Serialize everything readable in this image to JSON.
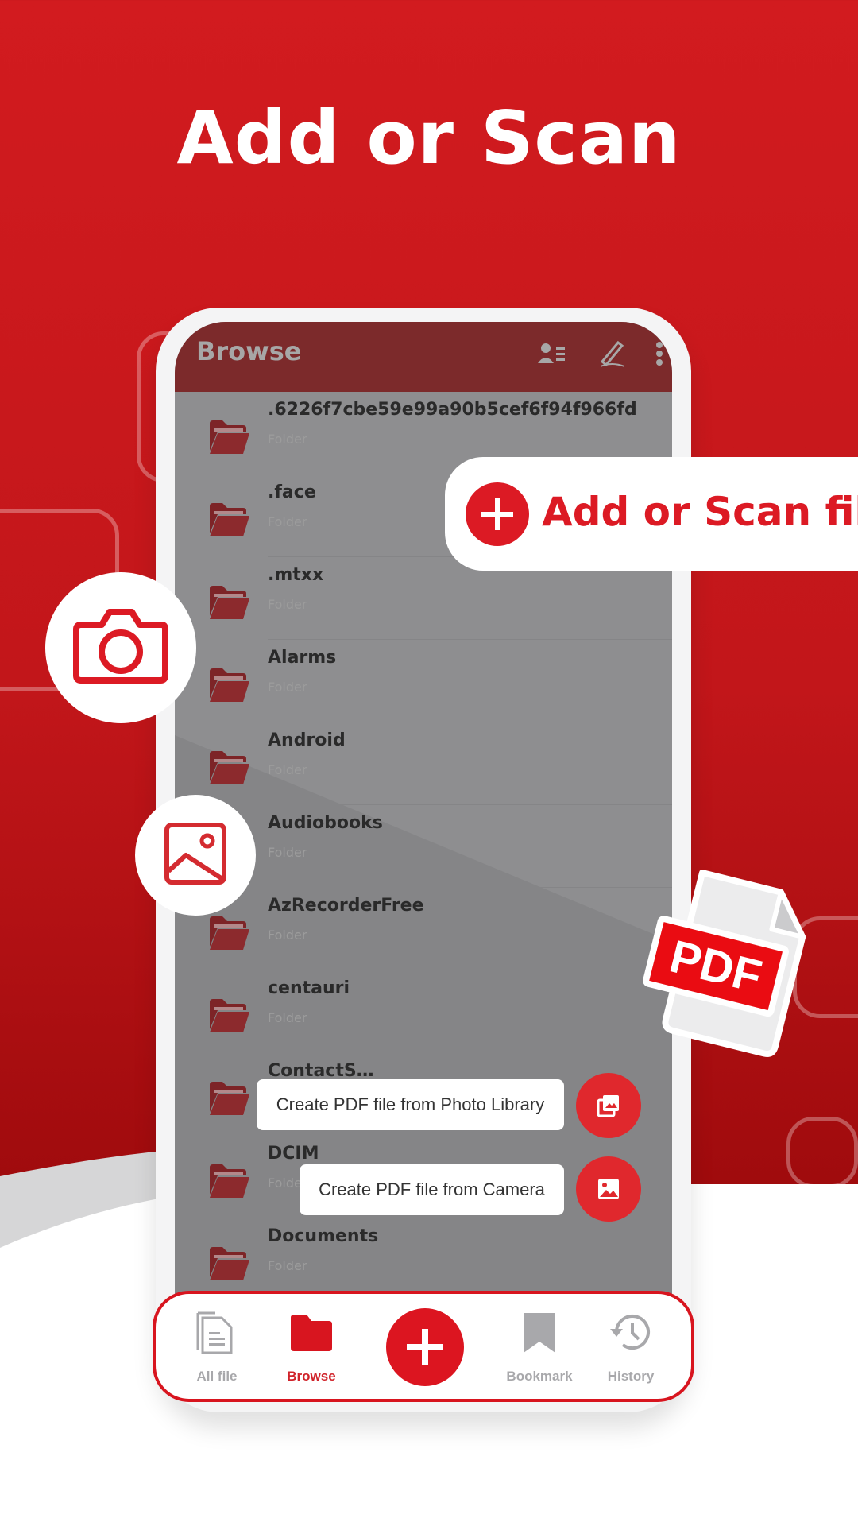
{
  "hero": {
    "title": "Add or Scan"
  },
  "colors": {
    "brand_red": "#dc1a24",
    "appbar": "#7c2a2b",
    "muted_icon": "#a8a8ab"
  },
  "app": {
    "title": "Browse",
    "toolbar_icons": [
      "contacts-list-icon",
      "signature-pen-icon",
      "more-vert-icon"
    ],
    "folders": [
      {
        "name": ".6226f7cbe59e99a90b5cef6f94f966fd",
        "type": "Folder"
      },
      {
        "name": ".face",
        "type": "Folder"
      },
      {
        "name": ".mtxx",
        "type": "Folder"
      },
      {
        "name": "Alarms",
        "type": "Folder"
      },
      {
        "name": "Android",
        "type": "Folder"
      },
      {
        "name": "Audiobooks",
        "type": "Folder"
      },
      {
        "name": "AzRecorderFree",
        "type": "Folder"
      },
      {
        "name": "centauri",
        "type": "Folder"
      },
      {
        "name": "ContactS…",
        "type": "Folder"
      },
      {
        "name": "DCIM",
        "type": "Folder"
      },
      {
        "name": "Documents",
        "type": "Folder"
      }
    ]
  },
  "callout": {
    "label": "Add or Scan file",
    "icon": "plus-icon"
  },
  "floating": {
    "camera_icon": "camera-icon",
    "gallery_icon": "image-icon",
    "pdf_badge": "PDF"
  },
  "speed_dial": [
    {
      "label": "Create PDF file from Photo Library",
      "icon": "photo-library-icon"
    },
    {
      "label": "Create PDF file from Camera",
      "icon": "image-icon"
    }
  ],
  "bottom_nav": {
    "items": [
      {
        "label": "All file",
        "icon": "document-icon",
        "active": false
      },
      {
        "label": "Browse",
        "icon": "folder-icon",
        "active": true
      },
      {
        "label": "Bookmark",
        "icon": "bookmark-icon",
        "active": false
      },
      {
        "label": "History",
        "icon": "history-icon",
        "active": false
      }
    ],
    "center_action": "plus-icon"
  }
}
